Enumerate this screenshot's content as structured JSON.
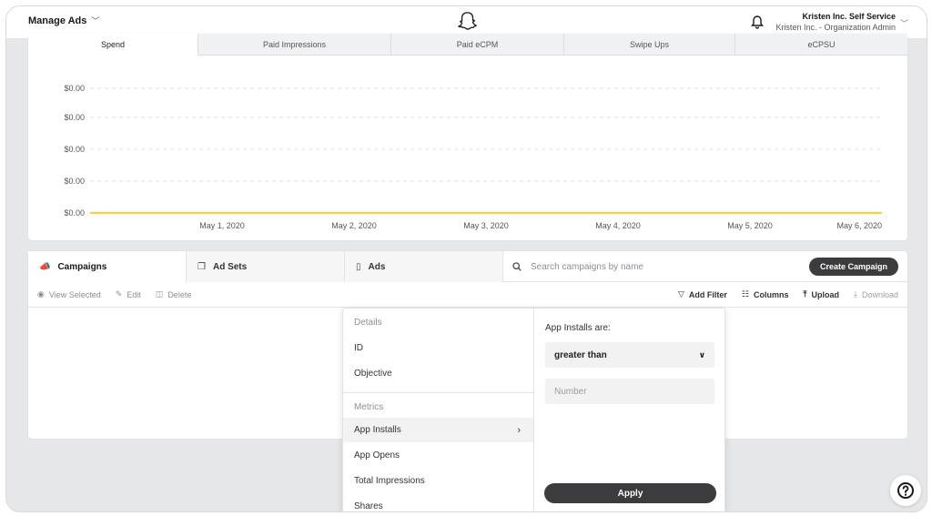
{
  "header": {
    "brand": "Manage Ads",
    "account_name": "Kristen Inc. Self Service",
    "account_role": "Kristen Inc. - Organization Admin"
  },
  "chart_tabs": [
    "Spend",
    "Paid Impressions",
    "Paid eCPM",
    "Swipe Ups",
    "eCPSU"
  ],
  "chart_data": {
    "type": "line",
    "x": [
      "May 1, 2020",
      "May 2, 2020",
      "May 3, 2020",
      "May 4, 2020",
      "May 5, 2020",
      "May 6, 2020"
    ],
    "y_ticks": [
      "$0.00",
      "$0.00",
      "$0.00",
      "$0.00",
      "$0.00"
    ],
    "series": [
      {
        "values": [
          0,
          0,
          0,
          0,
          0,
          0
        ],
        "color": "#ffcf40"
      }
    ],
    "grid": true
  },
  "entity_tabs": {
    "campaigns": "Campaigns",
    "ad_sets": "Ad Sets",
    "ads": "Ads"
  },
  "search": {
    "placeholder": "Search campaigns by name"
  },
  "create_button": "Create Campaign",
  "actions": {
    "view_selected": "View Selected",
    "edit": "Edit",
    "delete": "Delete",
    "add_filter": "Add Filter",
    "columns": "Columns",
    "upload": "Upload",
    "download": "Download"
  },
  "filter": {
    "section_details": "Details",
    "id": "ID",
    "objective": "Objective",
    "section_metrics": "Metrics",
    "app_installs": "App Installs",
    "app_opens": "App Opens",
    "total_impressions": "Total Impressions",
    "shares": "Shares",
    "condition_label": "App Installs are:",
    "operator": "greater than",
    "number_placeholder": "Number",
    "apply": "Apply"
  },
  "colors": {
    "accent_line": "#ffcf40",
    "dark_button": "#3c3c3e"
  }
}
